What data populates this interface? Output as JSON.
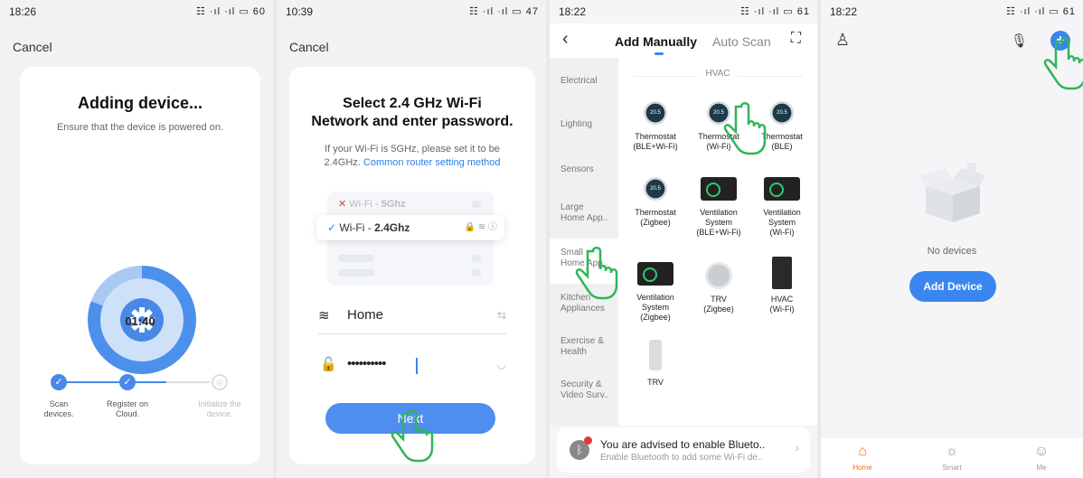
{
  "phone1": {
    "time": "18:26",
    "status_icons": "☷ ·ıl ·ıl ▭ 60",
    "cancel": "Cancel",
    "title": "Adding device...",
    "subtitle": "Ensure that the device is powered on.",
    "timer": "01:40",
    "progress": 0.8,
    "steps": [
      "Scan\ndevices.",
      "Register on\nCloud.",
      "Initialize the\ndevice."
    ]
  },
  "phone2": {
    "time": "10:39",
    "status_icons": "☷ ·ıl ·ıl ▭ 47",
    "cancel": "Cancel",
    "title_line1": "Select 2.4 GHz Wi-Fi",
    "title_line2": "Network and enter password.",
    "hint": "If your Wi-Fi is 5GHz, please set it to be 2.4GHz.",
    "hint_link": "Common router setting method",
    "wifi_5g_prefix": "Wi-Fi - ",
    "wifi_5g_bold": "5Ghz",
    "wifi_24_prefix": "Wi-Fi - ",
    "wifi_24_bold": "2.4Ghz",
    "ssid": "Home",
    "password": "••••••••••",
    "next": "Next"
  },
  "phone3": {
    "time": "18:22",
    "status_icons": "☷ ·ıl ·ıl ▭ 61",
    "tab_manual": "Add Manually",
    "tab_auto": "Auto Scan",
    "section": "HVAC",
    "categories": [
      "Electrical",
      "Lighting",
      "Sensors",
      "Large\nHome App..",
      "Small\nHome App..",
      "Kitchen\nAppliances",
      "Exercise &\nHealth",
      "Security &\nVideo Surv.."
    ],
    "devices": [
      "Thermostat\n(BLE+Wi-Fi)",
      "Thermostat\n(Wi-Fi)",
      "Thermostat\n(BLE)",
      "Thermostat\n(Zigbee)",
      "Ventilation\nSystem\n(BLE+Wi-Fi)",
      "Ventilation\nSystem\n(Wi-Fi)",
      "Ventilation\nSystem\n(Zigbee)",
      "TRV\n(Zigbee)",
      "HVAC\n(Wi-Fi)",
      "TRV"
    ],
    "thermo_reading": "20.5",
    "bt_title": "You are advised to enable Blueto..",
    "bt_sub": "Enable Bluetooth to add some Wi-Fi de.."
  },
  "phone4": {
    "time": "18:22",
    "status_icons": "☷ ·ıl ·ıl ▭ 61",
    "empty": "No devices",
    "add_device": "Add Device",
    "tabs": [
      "Home",
      "Smart",
      "Me"
    ],
    "accent": "#ff6a00"
  }
}
